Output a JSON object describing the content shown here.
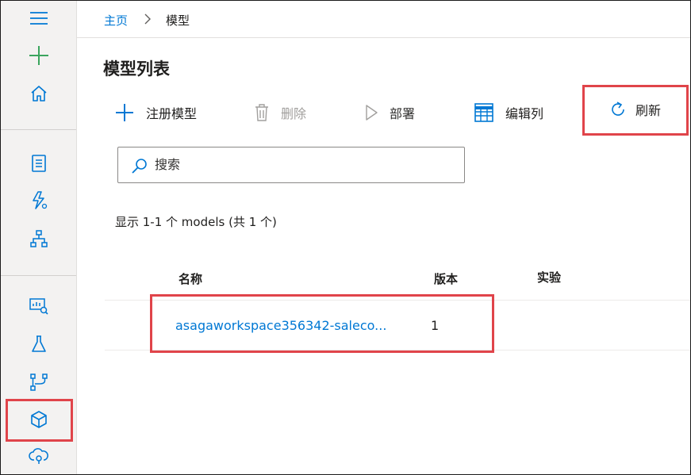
{
  "breadcrumb": {
    "home": "主页",
    "current": "模型"
  },
  "page": {
    "title": "模型列表"
  },
  "toolbar": {
    "register": "注册模型",
    "delete": "删除",
    "deploy": "部署",
    "edit_columns": "编辑列",
    "refresh": "刷新"
  },
  "search": {
    "placeholder": "搜索"
  },
  "list": {
    "count_text": "显示 1-1 个 models (共 1 个)",
    "columns": [
      "名称",
      "版本",
      "实验"
    ],
    "rows": [
      {
        "name": "asagaworkspace356342-saleco...",
        "version": "1",
        "experiment": ""
      }
    ]
  },
  "sidebar": {
    "icons": [
      "hamburger-menu-icon",
      "plus-icon",
      "home-icon",
      "notebook-icon",
      "automl-icon",
      "designer-icon",
      "datasets-icon",
      "experiments-icon",
      "pipelines-icon",
      "models-icon",
      "endpoints-icon"
    ],
    "selected": "models-icon"
  },
  "colors": {
    "accent": "#0078d4",
    "plus": "#3aa55d",
    "highlight": "#e0444a"
  }
}
